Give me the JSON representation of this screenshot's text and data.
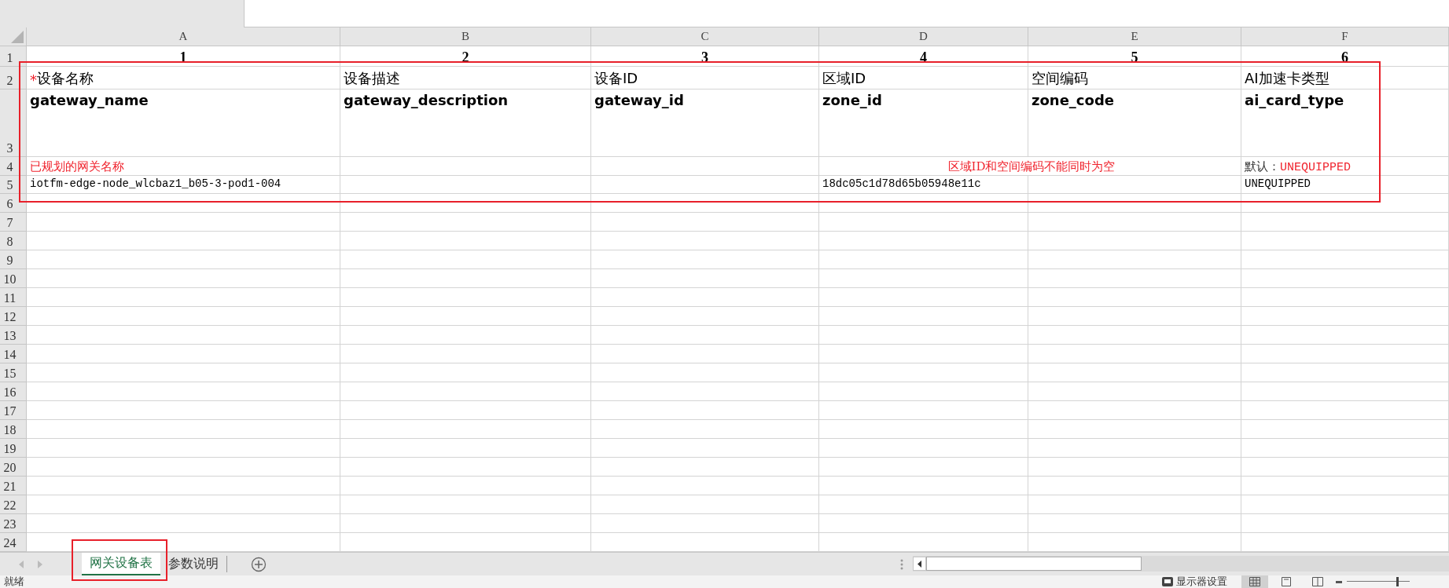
{
  "columns": [
    "A",
    "B",
    "C",
    "D",
    "E",
    "F"
  ],
  "row_numbers": [
    "1",
    "2",
    "3",
    "4",
    "5",
    "6",
    "7",
    "8",
    "9",
    "10",
    "11",
    "12",
    "13",
    "14",
    "15",
    "16",
    "17",
    "18",
    "19",
    "20",
    "21",
    "22",
    "23",
    "24"
  ],
  "rows": [
    {
      "kind": "index",
      "cells": [
        "1",
        "2",
        "3",
        "4",
        "5",
        "6"
      ]
    },
    {
      "kind": "label",
      "cells": [
        {
          "mark": "*",
          "text": "设备名称"
        },
        {
          "text": "设备描述"
        },
        {
          "text": "设备ID"
        },
        {
          "text": "区域ID"
        },
        {
          "text": "空间编码"
        },
        {
          "text": "AI加速卡类型"
        }
      ]
    },
    {
      "kind": "key",
      "cells": [
        "gateway_name",
        "gateway_description",
        "gateway_id",
        "zone_id",
        "zone_code",
        "ai_card_type"
      ]
    },
    {
      "kind": "note",
      "cells": [
        "已规划的网关名称",
        null,
        null,
        {
          "text": "区域ID和空间编码不能同时为空",
          "merged": true
        },
        {
          "prefix": "默认：",
          "text": "UNEQUIPPED"
        }
      ]
    },
    {
      "kind": "value",
      "cells": [
        "iotfm-edge-node_wlcbaz1_b05-3-pod1-004",
        null,
        null,
        "18dc05c1d78d65b05948e11c",
        null,
        "UNEQUIPPED"
      ]
    }
  ],
  "sheet_tabs": [
    {
      "label": "网关设备表",
      "selected": true
    },
    {
      "label": "参数说明",
      "selected": false
    }
  ],
  "status_bar": {
    "state": "就绪",
    "display_settings": "显示器设置",
    "zoom_slider": {
      "level": 0.8
    }
  }
}
